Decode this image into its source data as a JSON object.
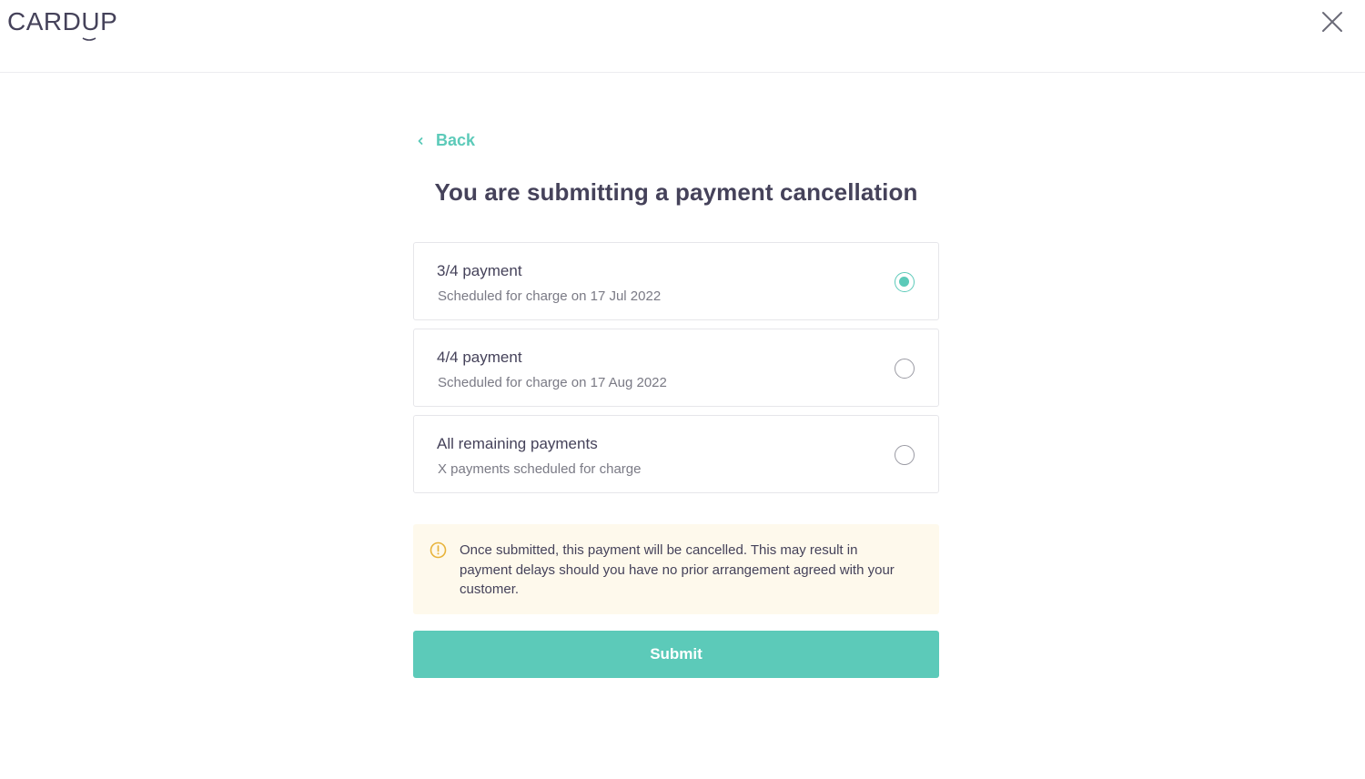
{
  "header": {
    "logo_text_before": "CARD",
    "logo_text_u": "U",
    "logo_text_after": "P",
    "close_icon": "close-icon"
  },
  "back": {
    "label": "Back",
    "icon": "chevron-left-icon"
  },
  "page_title": "You are submitting a payment cancellation",
  "options": [
    {
      "title": "3/4 payment",
      "subtitle": "Scheduled for charge on 17 Jul 2022",
      "selected": true
    },
    {
      "title": "4/4 payment",
      "subtitle": "Scheduled for charge on 17 Aug 2022",
      "selected": false
    },
    {
      "title": "All remaining payments",
      "subtitle": "X payments scheduled for charge",
      "selected": false
    }
  ],
  "warning": {
    "icon": "warning-icon",
    "text": "Once submitted, this payment will be cancelled. This may result in payment delays should you have no prior arrangement agreed with your customer."
  },
  "submit_label": "Submit",
  "colors": {
    "accent": "#5ccab9",
    "text": "#45425a",
    "warning_bg": "#fef9ec",
    "warning_icon": "#e8b33a"
  }
}
